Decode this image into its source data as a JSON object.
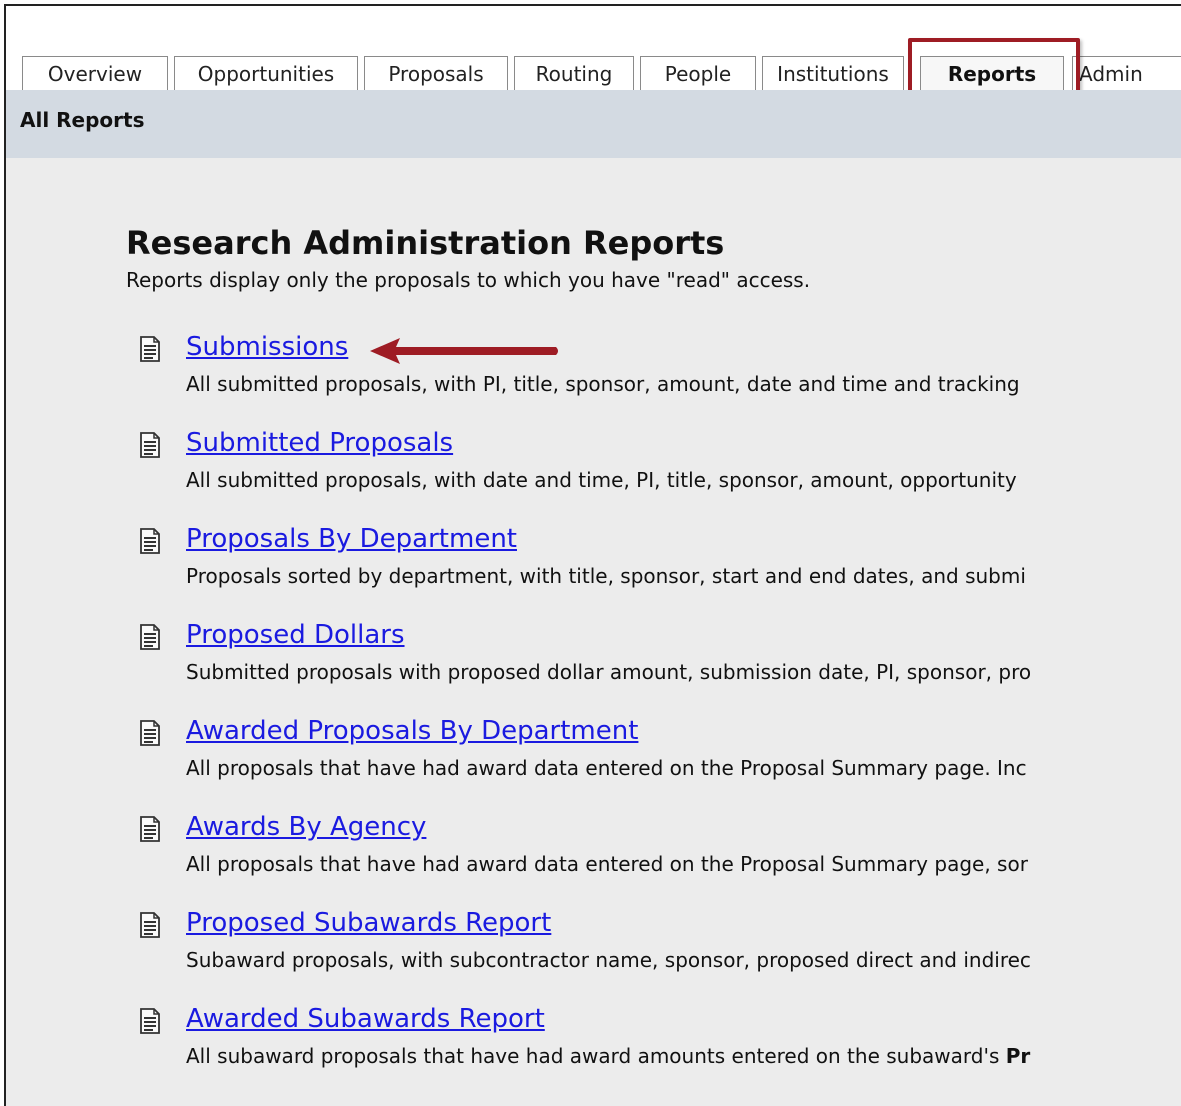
{
  "tabs": [
    {
      "label": "Overview"
    },
    {
      "label": "Opportunities"
    },
    {
      "label": "Proposals"
    },
    {
      "label": "Routing"
    },
    {
      "label": "People"
    },
    {
      "label": "Institutions"
    },
    {
      "label": "Reports",
      "active": true
    },
    {
      "label": "Admin"
    }
  ],
  "subheader": {
    "title": "All Reports"
  },
  "main": {
    "heading": "Research Administration Reports",
    "intro": "Reports display only the proposals to which you have \"read\" access."
  },
  "reports": [
    {
      "link": "Submissions",
      "desc": "All submitted proposals, with PI, title, sponsor, amount, date and time and tracking"
    },
    {
      "link": "Submitted Proposals",
      "desc": "All submitted proposals, with date and time, PI, title, sponsor, amount, opportunity"
    },
    {
      "link": "Proposals By Department",
      "desc": "Proposals sorted by department, with title, sponsor, start and end dates, and submi"
    },
    {
      "link": "Proposed Dollars",
      "desc": "Submitted proposals with proposed dollar amount, submission date, PI, sponsor, pro"
    },
    {
      "link": "Awarded Proposals By Department",
      "desc": "All proposals that have had award data entered on the Proposal Summary page. Inc"
    },
    {
      "link": "Awards By Agency",
      "desc": "All proposals that have had award data entered on the Proposal Summary page, sor"
    },
    {
      "link": "Proposed Subawards Report",
      "desc": "Subaward proposals, with subcontractor name, sponsor, proposed direct and indirec"
    },
    {
      "link": "Awarded Subawards Report",
      "desc": "All subaward proposals that have had award amounts entered on the subaward's ",
      "desc_bold": "Pr"
    }
  ],
  "colors": {
    "link": "#1a1ae0",
    "highlight": "#9e1c24",
    "subbar": "#d3dae2",
    "page_bg": "#ececec"
  },
  "icons": {
    "report": "document-icon",
    "pointer": "arrow-icon"
  }
}
